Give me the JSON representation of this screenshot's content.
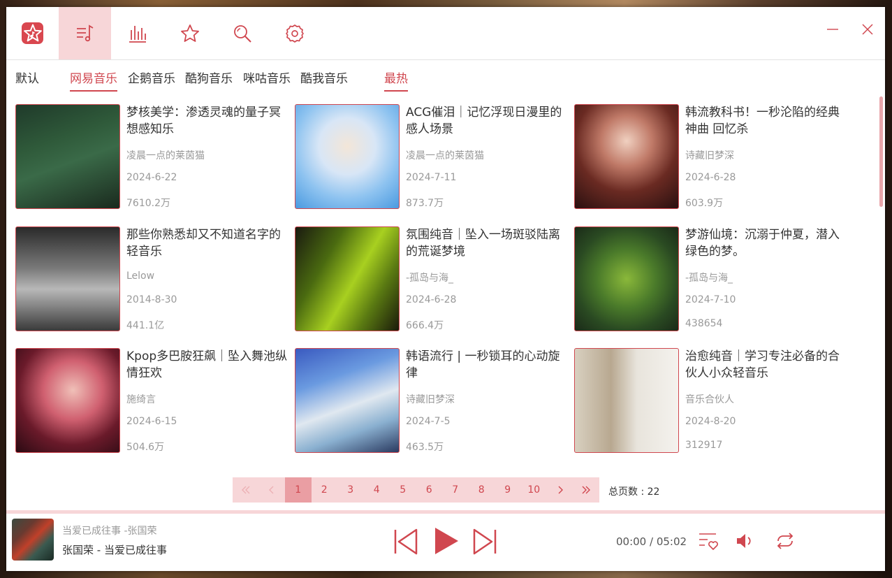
{
  "colors": {
    "accent": "#d0474f",
    "accent_light": "#f7d6d8",
    "page_active": "#ea9ea3"
  },
  "nav": [
    {
      "icon": "logo-star-music-icon"
    },
    {
      "icon": "playlist-icon",
      "active": true
    },
    {
      "icon": "equalizer-icon"
    },
    {
      "icon": "star-icon"
    },
    {
      "icon": "search-icon"
    },
    {
      "icon": "settings-icon"
    }
  ],
  "tabs": {
    "sources": [
      "默认",
      "网易音乐",
      "企鹅音乐",
      "酷狗音乐",
      "咪咕音乐",
      "酷我音乐"
    ],
    "active_source": "网易音乐",
    "sort": "最热"
  },
  "playlists": [
    {
      "title": "梦核美学：渗透灵魂的量子冥想感知乐",
      "author": "凌晨一点的莱茵猫",
      "date": "2024-6-22",
      "plays": "7610.2万"
    },
    {
      "title": "ACG催泪｜记忆浮现日漫里的感人场景",
      "author": "凌晨一点的莱茵猫",
      "date": "2024-7-11",
      "plays": "873.7万"
    },
    {
      "title": "韩流教科书！一秒沦陷的经典神曲 回忆杀",
      "author": "诗藏旧梦深",
      "date": "2024-6-28",
      "plays": "603.9万"
    },
    {
      "title": "那些你熟悉却又不知道名字的轻音乐",
      "author": "Lelow",
      "date": "2014-8-30",
      "plays": "441.1亿"
    },
    {
      "title": "氛围纯音｜坠入一场斑驳陆离的荒诞梦境",
      "author": "-孤岛与海_",
      "date": "2024-6-28",
      "plays": "666.4万"
    },
    {
      "title": "梦游仙境：沉溺于仲夏，潜入绿色的梦。",
      "author": "-孤岛与海_",
      "date": "2024-7-10",
      "plays": "438654"
    },
    {
      "title": "Kpop多巴胺狂飙｜坠入舞池纵情狂欢",
      "author": "施绮言",
      "date": "2024-6-15",
      "plays": "504.6万"
    },
    {
      "title": "韩语流行 | 一秒锁耳的心动旋律",
      "author": "诗藏旧梦深",
      "date": "2024-7-5",
      "plays": "463.5万"
    },
    {
      "title": "治愈纯音｜学习专注必备的合伙人小众轻音乐",
      "author": "音乐合伙人",
      "date": "2024-8-20",
      "plays": "312917"
    }
  ],
  "pagination": {
    "pages": [
      "1",
      "2",
      "3",
      "4",
      "5",
      "6",
      "7",
      "8",
      "9",
      "10"
    ],
    "current": "1",
    "total_label": "总页数 : 22"
  },
  "player": {
    "song_line": "当爱已成往事 -张国荣",
    "artist_title": "张国荣 - 当爱已成往事",
    "time": "00:00 / 05:02"
  }
}
